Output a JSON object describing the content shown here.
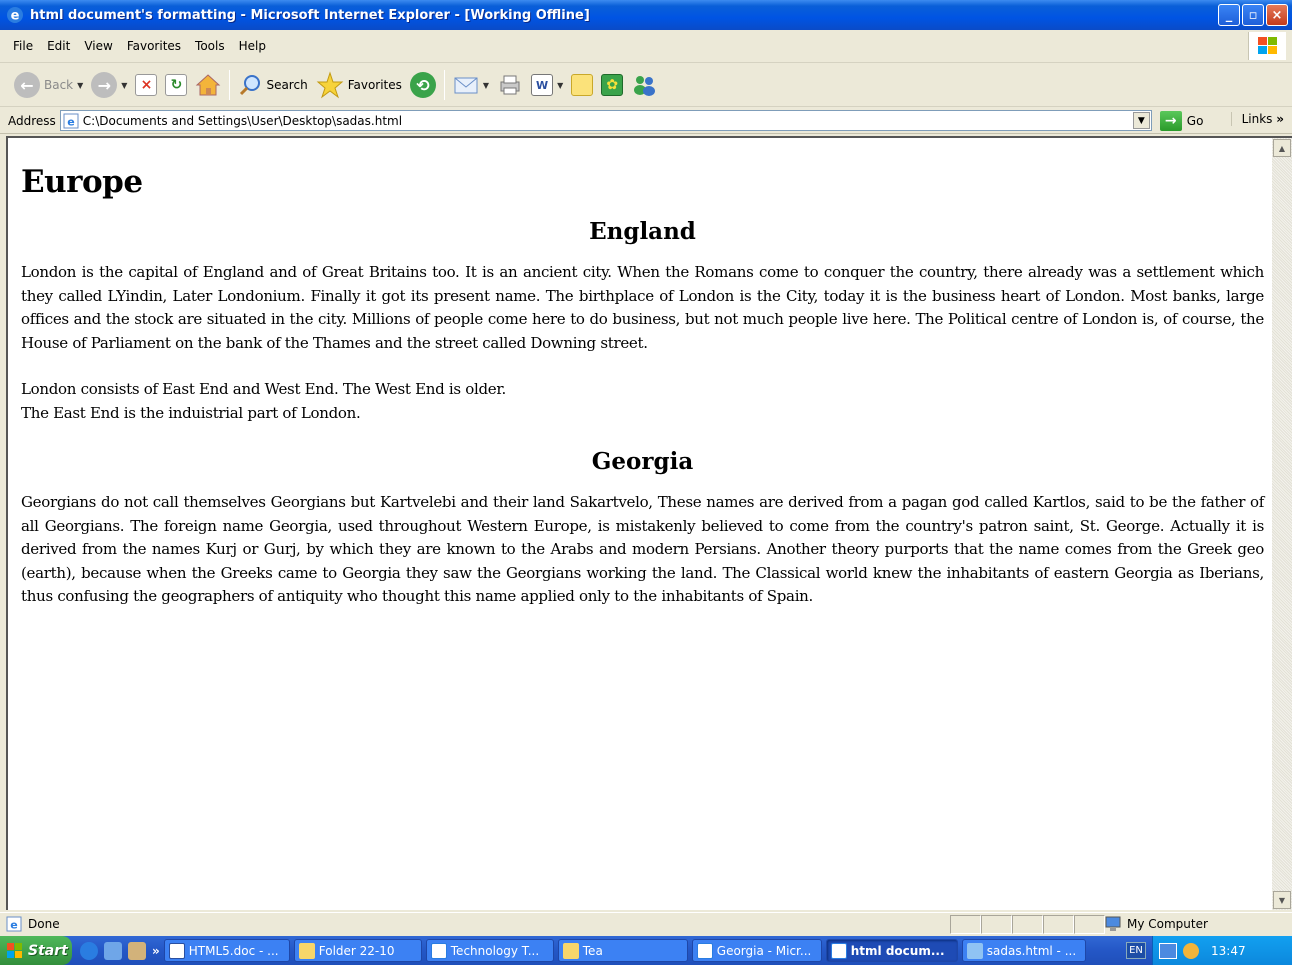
{
  "window": {
    "title": "html document's formatting - Microsoft Internet Explorer - [Working Offline]",
    "minimize": "_",
    "maximize": "▫",
    "close": "×"
  },
  "menu": [
    "File",
    "Edit",
    "View",
    "Favorites",
    "Tools",
    "Help"
  ],
  "toolbar": {
    "back": "Back",
    "search": "Search",
    "favorites": "Favorites"
  },
  "address": {
    "label": "Address",
    "url": "C:\\Documents and Settings\\User\\Desktop\\sadas.html",
    "go": "Go",
    "links": "Links"
  },
  "page": {
    "h1": "Europe",
    "england_heading": "England",
    "england_p1": "London is the capital of England and of Great Britains too. It is an ancient city. When the Romans come to conquer the country, there already was a settlement which they called LYindin, Later Londonium. Finally it got its present name. The birthplace of London is the City, today it is the business heart of London. Most banks, large offices and the stock are situated in the city. Millions of people come here to do business, but not much people live here. The Political centre of London is, of course, the House of Parliament on the bank of the Thames and the street called Downing street.",
    "england_p2_line1": "London consists of East End and West End. The West End is older.",
    "england_p2_line2": "The East End is the induistrial part of London.",
    "georgia_heading": "Georgia",
    "georgia_p1": "Georgians do not call themselves Georgians but Kartvelebi and their land Sakartvelo, These names are derived from a pagan god called Kartlos, said to be the father of all Georgians. The foreign name Georgia, used throughout Western Europe, is mistakenly believed to come from the country's patron saint, St. George. Actually it is derived from the names Kurj or Gurj, by which they are known to the Arabs and modern Persians. Another theory purports that the name comes from the Greek geo (earth), because when the Greeks came to Georgia they saw the Georgians working the land. The Classical world knew the inhabitants of eastern Georgia as Iberians, thus confusing the geographers of antiquity who thought this name applied only to the inhabitants of Spain."
  },
  "status": {
    "text": "Done",
    "zone": "My Computer"
  },
  "taskbar": {
    "start": "Start",
    "chevron": "»",
    "tasks": [
      {
        "label": "HTML5.doc - ...",
        "icon": "word-icon",
        "active": false
      },
      {
        "label": "Folder 22-10",
        "icon": "folder-icon",
        "active": false
      },
      {
        "label": "Technology T...",
        "icon": "ie-icon",
        "active": false
      },
      {
        "label": "Tea",
        "icon": "folder-icon",
        "active": false
      },
      {
        "label": "Georgia - Micr...",
        "icon": "ie-icon",
        "active": false
      },
      {
        "label": "html docum...",
        "icon": "ie-icon",
        "active": true
      },
      {
        "label": "sadas.html - ...",
        "icon": "notepad-icon",
        "active": false
      }
    ],
    "lang": "EN",
    "clock": "13:47"
  },
  "colors": {
    "titlebar": "#0054e3",
    "taskbar": "#2457c6",
    "tray": "#12a0f0",
    "start": "#3f9f49"
  }
}
